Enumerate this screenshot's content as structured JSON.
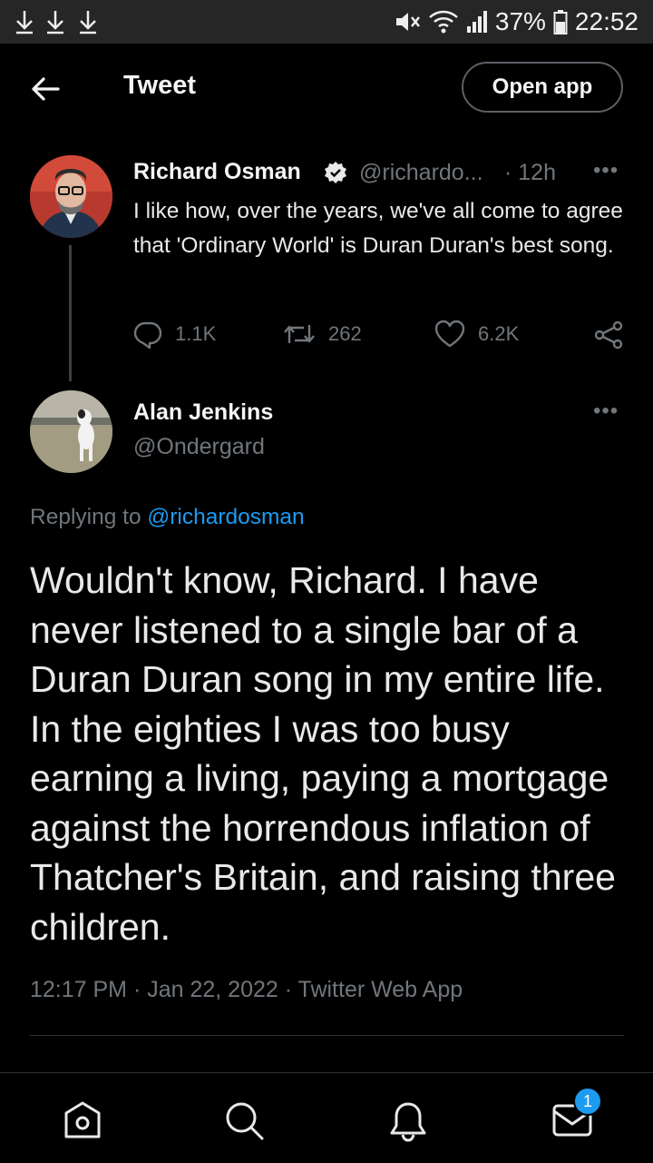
{
  "statusbar": {
    "battery": "37%",
    "time": "22:52"
  },
  "header": {
    "title": "Tweet",
    "open_app_label": "Open app"
  },
  "tweet": {
    "author_name": "Richard Osman",
    "author_handle": "@richardo...",
    "time_ago": "· 12h",
    "text": "I like how, over the years, we've all come to agree that 'Ordinary World' is Duran Duran's best song.",
    "replies": "1.1K",
    "retweets": "262",
    "likes": "6.2K"
  },
  "reply": {
    "author_name": "Alan Jenkins",
    "author_handle": "@Ondergard",
    "replying_prefix": "Replying to",
    "replying_to": "@richardosman",
    "text": "Wouldn't know, Richard. I have never listened to a single bar of a Duran Duran song in my entire life. In the eighties I was too busy earning a living, paying a mortgage against the horrendous inflation of Thatcher's Britain, and raising three children.",
    "timestamp": "12:17 PM · Jan 22, 2022 · Twitter Web App"
  },
  "bottomnav": {
    "messages_badge": "1"
  },
  "colors": {
    "background": "#000000",
    "accent": "#1d9bf0",
    "secondary_text": "#71767b"
  }
}
